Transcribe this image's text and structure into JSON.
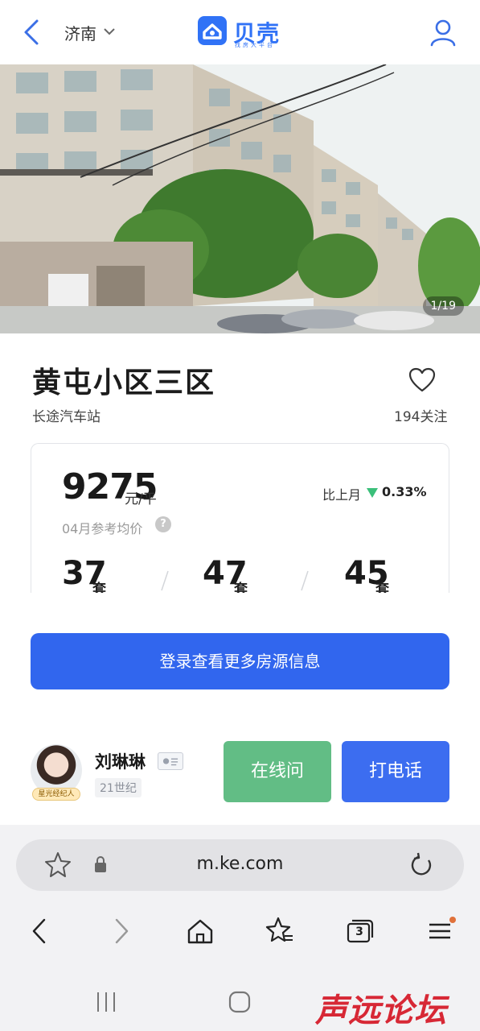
{
  "nav": {
    "city": "济南",
    "logo_text": "贝壳",
    "logo_sub": "找房大平台",
    "icons": {
      "back": "back-arrow-icon",
      "city_dropdown": "chevron-down-icon",
      "user": "user-icon"
    }
  },
  "gallery": {
    "counter": "1/19"
  },
  "community": {
    "name": "黄屯小区三区",
    "location": "长途汽车站",
    "follow_count": "194关注"
  },
  "price_card": {
    "price": "9275",
    "unit": "元/平",
    "compare_label": "比上月",
    "compare_value": "0.33%",
    "compare_direction": "down",
    "compare_color": "#3bbf7a",
    "reference_label": "04月参考均价",
    "stats": [
      {
        "value": "37",
        "unit": "套"
      },
      {
        "value": "47",
        "unit": "套"
      },
      {
        "value": "45",
        "unit": "套"
      }
    ]
  },
  "login_button": "登录查看更多房源信息",
  "agent": {
    "name": "刘琳琳",
    "company": "21世纪",
    "badge": "星光经纪人",
    "online_button": "在线问",
    "call_button": "打电话"
  },
  "browser": {
    "url": "m.ke.com",
    "tab_count": "3"
  },
  "watermark": "声远论坛",
  "colors": {
    "brand": "#3072f6",
    "login": "#3166ee",
    "online": "#62bd85",
    "call": "#3c6df0"
  }
}
